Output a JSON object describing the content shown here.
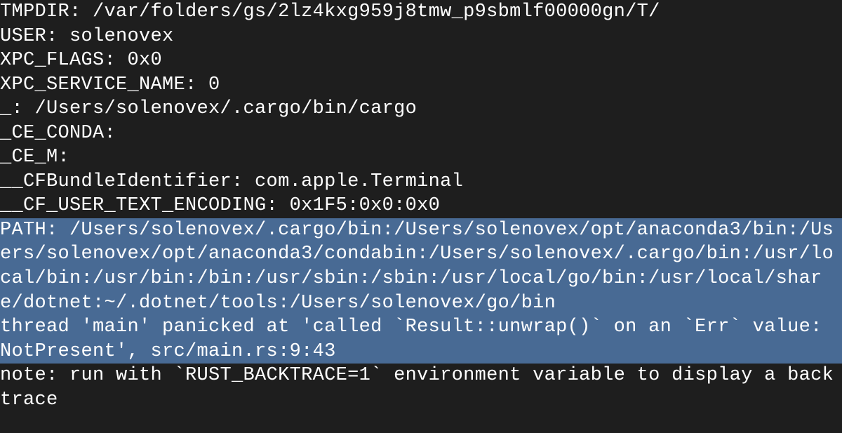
{
  "terminal": {
    "lines": [
      "TMPDIR: /var/folders/gs/2lz4kxg959j8tmw_p9sbmlf00000gn/T/",
      "USER: solenovex",
      "XPC_FLAGS: 0x0",
      "XPC_SERVICE_NAME: 0",
      "_: /Users/solenovex/.cargo/bin/cargo",
      "_CE_CONDA:",
      "_CE_M:",
      "__CFBundleIdentifier: com.apple.Terminal",
      "__CF_USER_TEXT_ENCODING: 0x1F5:0x0:0x0"
    ],
    "highlighted_lines": [
      "PATH: /Users/solenovex/.cargo/bin:/Users/solenovex/opt/anaconda3/bin:/Users/solenovex/opt/anaconda3/condabin:/Users/solenovex/.cargo/bin:/usr/local/bin:/usr/bin:/bin:/usr/sbin:/sbin:/usr/local/go/bin:/usr/local/share/dotnet:~/.dotnet/tools:/Users/solenovex/go/bin",
      "thread 'main' panicked at 'called `Result::unwrap()` on an `Err` value: NotPresent', src/main.rs:9:43"
    ],
    "trailing_lines": [
      "note: run with `RUST_BACKTRACE=1` environment variable to display a backtrace"
    ]
  }
}
